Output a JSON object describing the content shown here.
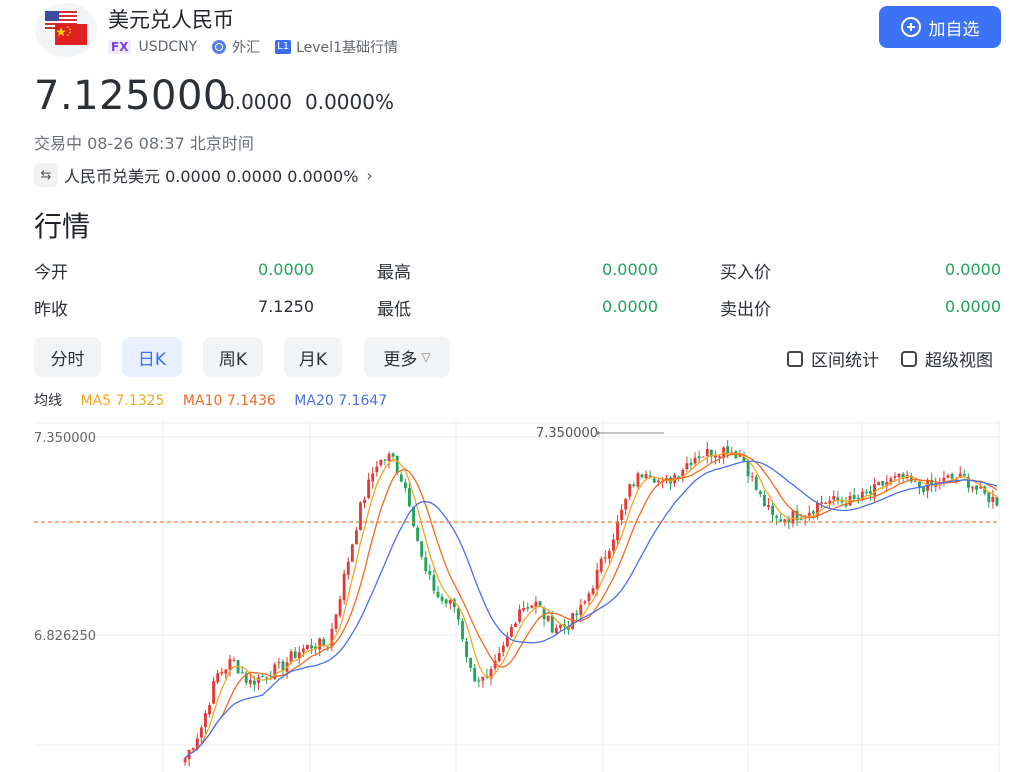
{
  "header": {
    "title": "美元兑人民币",
    "market_tag": "FX",
    "symbol": "USDCNY",
    "category": "外汇",
    "level_badge": "L1",
    "level_text": "Level1基础行情",
    "add_button": "加自选"
  },
  "quote": {
    "price": "7.125000",
    "change": "0.0000",
    "change_pct": "0.0000%",
    "status": "交易中 08-26 08:37 北京时间",
    "inverse": "人民币兑美元 0.0000 0.0000 0.0000%"
  },
  "market": {
    "section_title": "行情",
    "stats": [
      {
        "label": "今开",
        "value": "0.0000"
      },
      {
        "label": "最高",
        "value": "0.0000"
      },
      {
        "label": "买入价",
        "value": "0.0000"
      },
      {
        "label": "昨收",
        "value": "7.1250"
      },
      {
        "label": "最低",
        "value": "0.0000"
      },
      {
        "label": "卖出价",
        "value": "0.0000"
      }
    ],
    "colors": {
      "up": "#21a35a",
      "accent": "#3b72f6"
    }
  },
  "tabs": [
    {
      "label": "分时",
      "active": false
    },
    {
      "label": "日K",
      "active": true
    },
    {
      "label": "周K",
      "active": false
    },
    {
      "label": "月K",
      "active": false
    },
    {
      "label": "更多",
      "active": false
    }
  ],
  "tools": {
    "interval_stats": "区间统计",
    "super_view": "超级视图"
  },
  "ma": {
    "label": "均线",
    "ma5": "MA5 7.1325",
    "ma10": "MA10 7.1436",
    "ma20": "MA20 7.1647",
    "colors": {
      "ma5": "#f5a623",
      "ma10": "#f26b21",
      "ma20": "#4a6fe8"
    }
  },
  "chart_data": {
    "type": "candlestick",
    "y_tick_labels": [
      "7.350000",
      "6.826250"
    ],
    "high_marker": "7.350000",
    "reference_line": 7.125,
    "ylim": [
      6.51,
      7.39
    ],
    "grid": true,
    "colors": {
      "up": "#e53935",
      "down": "#21a35a",
      "reference": "#f26b21"
    },
    "close_profile": [
      6.5,
      6.58,
      6.72,
      6.76,
      6.7,
      6.72,
      6.74,
      6.78,
      6.8,
      6.8,
      6.98,
      7.16,
      7.28,
      7.3,
      7.2,
      7.0,
      6.92,
      6.9,
      6.72,
      6.7,
      6.79,
      6.9,
      6.91,
      6.85,
      6.85,
      6.9,
      7.0,
      7.1,
      7.22,
      7.27,
      7.22,
      7.26,
      7.3,
      7.31,
      7.32,
      7.3,
      7.2,
      7.13,
      7.14,
      7.15,
      7.18,
      7.18,
      7.18,
      7.2,
      7.23,
      7.24,
      7.22,
      7.22,
      7.24,
      7.24,
      7.2,
      7.18
    ],
    "ma5": "MA5 7.1325",
    "ma10": "MA10 7.1436",
    "ma20": "MA20 7.1647"
  }
}
